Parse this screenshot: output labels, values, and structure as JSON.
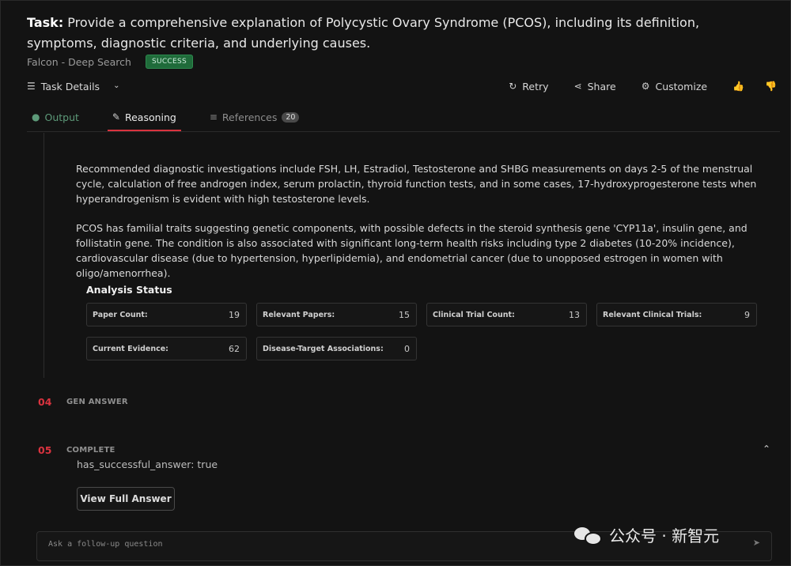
{
  "task": {
    "prefix": "Task:",
    "text": " Provide a comprehensive explanation of Polycystic Ovary Syndrome (PCOS), including its definition, symptoms, diagnostic criteria, and underlying causes.",
    "agent": "Falcon - Deep Search",
    "status": "SUCCESS"
  },
  "toolbar": {
    "details_label": "Task Details",
    "retry_label": "Retry",
    "share_label": "Share",
    "customize_label": "Customize"
  },
  "tabs": {
    "output": "Output",
    "reasoning": "Reasoning",
    "references": "References",
    "references_count": "20"
  },
  "content": {
    "para1": "Recommended diagnostic investigations include FSH, LH, Estradiol, Testosterone and SHBG measurements on days 2-5 of the menstrual cycle, calculation of free androgen index, serum prolactin, thyroid function tests, and in some cases, 17-hydroxyprogesterone tests when hyperandrogenism is evident with high testosterone levels.",
    "para2": "PCOS has familial traits suggesting genetic components, with possible defects in the steroid synthesis gene 'CYP11a', insulin gene, and follistatin gene. The condition is also associated with significant long-term health risks including type 2 diabetes (10-20% incidence), cardiovascular disease (due to hypertension, hyperlipidemia), and endometrial cancer (due to unopposed estrogen in women with oligo/amenorrhea)."
  },
  "analysis": {
    "title": "Analysis Status",
    "stats": [
      {
        "label": "Paper Count:",
        "value": "19"
      },
      {
        "label": "Relevant Papers:",
        "value": "15"
      },
      {
        "label": "Clinical Trial Count:",
        "value": "13"
      },
      {
        "label": "Relevant Clinical Trials:",
        "value": "9"
      },
      {
        "label": "Current Evidence:",
        "value": "62"
      },
      {
        "label": "Disease-Target Associations:",
        "value": "0"
      }
    ]
  },
  "steps": [
    {
      "num": "04",
      "label": "GEN ANSWER"
    },
    {
      "num": "05",
      "label": "COMPLETE"
    }
  ],
  "complete": {
    "flag": "has_successful_answer: true",
    "view_button": "View Full Answer"
  },
  "followup": {
    "placeholder": "Ask a follow-up question"
  },
  "watermark": {
    "text": "公众号 · 新智元"
  },
  "colors": {
    "accent": "#d9333f",
    "success": "#1f6b3a",
    "background": "#131313"
  }
}
